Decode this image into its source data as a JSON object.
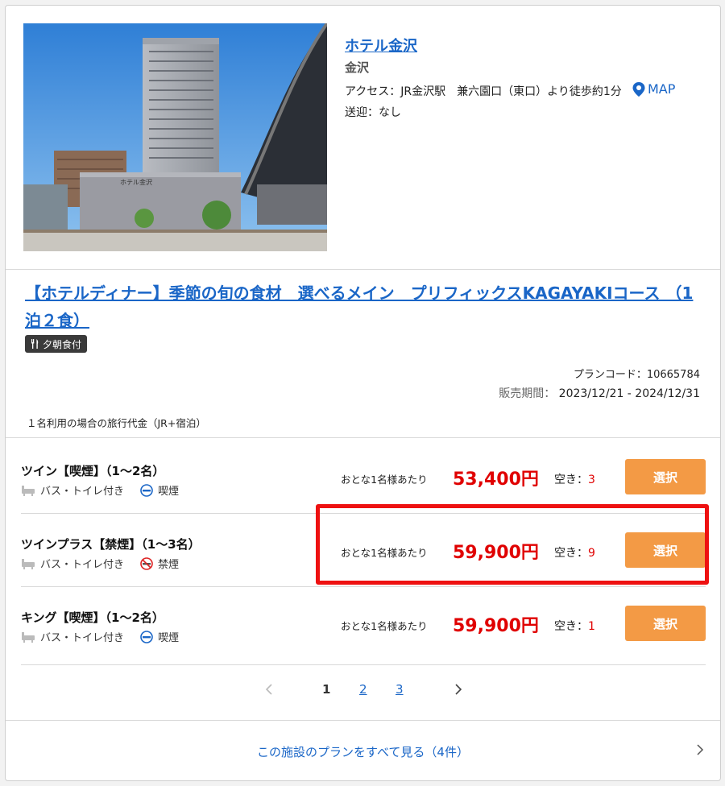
{
  "hotel": {
    "name": "ホテル金沢",
    "area": "金沢",
    "access": "アクセス：JR金沢駅　兼六園口（東口）より徒歩約1分",
    "map_label": "MAP",
    "pickup": "送迎：なし",
    "photo_sign": "ホテル金沢"
  },
  "plan": {
    "title": "【ホテルディナー】季節の旬の食材　選べるメイン　プリフィックスKAGAYAKIコース （1泊２食）",
    "meal_badge": "夕朝食付",
    "plan_code": "プランコード：10665784",
    "sale_period_label": "販売期間：",
    "sale_period_value": "2023/12/21 - 2024/12/31",
    "price_note": "１名利用の場合の旅行代金（JR+宿泊）"
  },
  "rooms": [
    {
      "name": "ツイン【喫煙】（1〜2名）",
      "bath": "バス・トイレ付き",
      "smoking": "喫煙",
      "per_adult": "おとな1名様あたり",
      "price": "53,400円",
      "avail_label": "空き：",
      "avail": "3",
      "button": "選択"
    },
    {
      "name": "ツインプラス【禁煙】（1〜3名）",
      "bath": "バス・トイレ付き",
      "smoking": "禁煙",
      "per_adult": "おとな1名様あたり",
      "price": "59,900円",
      "avail_label": "空き：",
      "avail": "9",
      "button": "選択"
    },
    {
      "name": "キング【喫煙】（1〜2名）",
      "bath": "バス・トイレ付き",
      "smoking": "喫煙",
      "per_adult": "おとな1名様あたり",
      "price": "59,900円",
      "avail_label": "空き：",
      "avail": "1",
      "button": "選択"
    }
  ],
  "pagination": {
    "pages": [
      "1",
      "2",
      "3"
    ],
    "current": "1"
  },
  "footer": {
    "all_plans": "この施設のプランをすべて見る（4件）"
  },
  "colors": {
    "link": "#1a66c7",
    "price": "#e00000",
    "button": "#f39a45",
    "highlight": "#ee1111"
  }
}
